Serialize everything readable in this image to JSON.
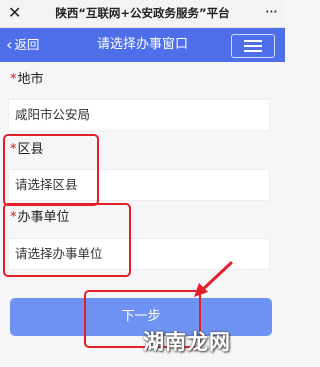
{
  "topbar": {
    "close_icon": "✕",
    "title": "陕西“互联网+公安政务服务”平台",
    "more_icon": "···"
  },
  "navbar": {
    "back_label": "返回",
    "back_icon": "‹",
    "title": "请选择办事窗口",
    "menu_icon": "hamburger-menu-icon"
  },
  "form": {
    "required_mark": "*",
    "city": {
      "label": "地市",
      "value": "咸阳市公安局"
    },
    "county": {
      "label": "区县",
      "placeholder": "请选择区县"
    },
    "unit": {
      "label": "办事单位",
      "placeholder": "请选择办事单位"
    }
  },
  "next_button": {
    "label": "下一步"
  },
  "watermark": "湖南龙网",
  "colors": {
    "nav_blue": "#4f6eea",
    "button_blue": "#6f93f3",
    "annotation_red": "#e31f2a",
    "required_red": "#e0141e"
  }
}
